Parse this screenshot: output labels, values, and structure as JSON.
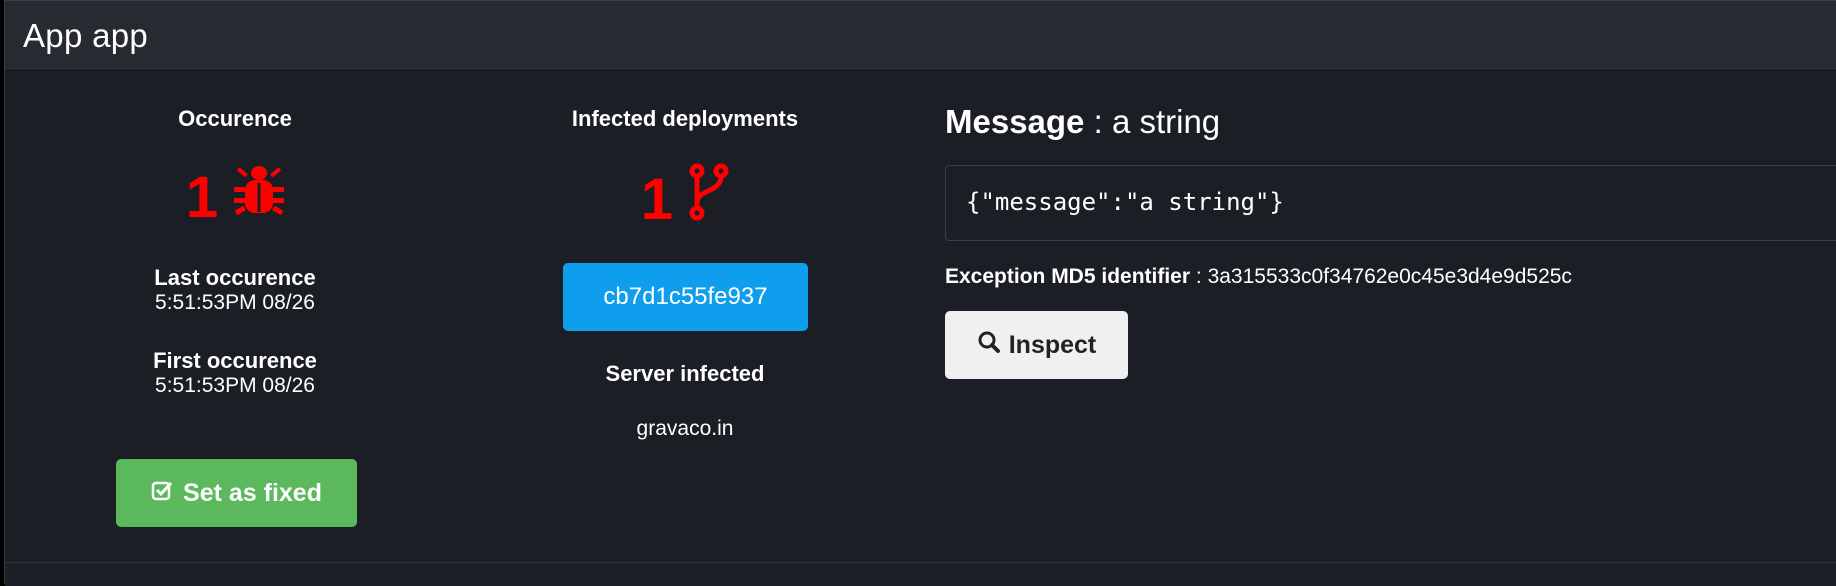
{
  "app": {
    "title": "App app"
  },
  "occurrence": {
    "heading": "Occurence",
    "count": "1",
    "count_icon": "bug-icon",
    "last_label": "Last occurence",
    "last_value": "5:51:53PM 08/26",
    "first_label": "First occurence",
    "first_value": "5:51:53PM 08/26",
    "fixed_button": "Set as fixed",
    "fixed_icon": "check-square-icon"
  },
  "deployments": {
    "heading": "Infected deployments",
    "count": "1",
    "count_icon": "code-fork-icon",
    "commit": "cb7d1c55fe937",
    "server_label": "Server infected",
    "server_value": "gravaco.in"
  },
  "message": {
    "label": "Message",
    "separator": ":",
    "value": "a string",
    "json": "{\"message\":\"a string\"}",
    "md5_label": "Exception MD5 identifier",
    "md5_separator": ":",
    "md5_value": "3a315533c0f34762e0c45e3d4e9d525c",
    "inspect_button": "Inspect",
    "inspect_icon": "search-icon"
  },
  "colors": {
    "accent_red": "#ff0000",
    "success_green": "#5cb85c",
    "info_blue": "#0f9ded",
    "panel_bg": "#1b1e24",
    "header_bg": "#272b31"
  }
}
